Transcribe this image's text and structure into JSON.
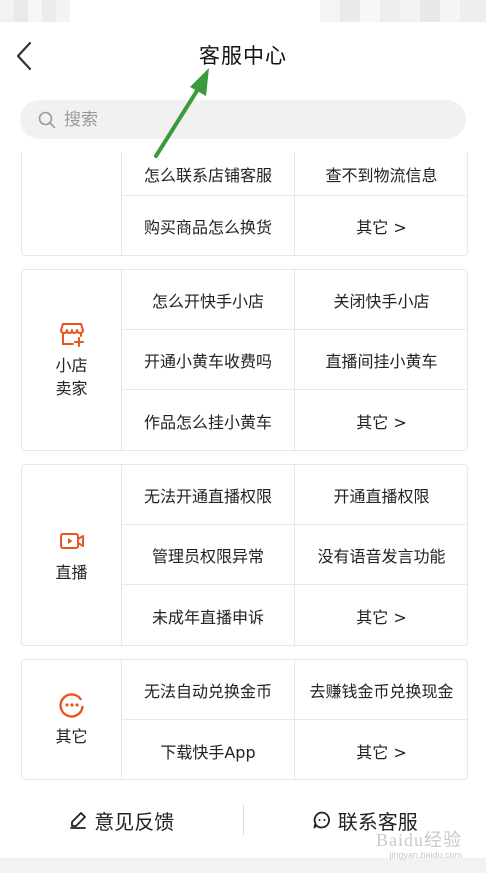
{
  "header": {
    "title": "客服中心"
  },
  "search": {
    "placeholder": "搜索"
  },
  "colors": {
    "accent": "#e8561f",
    "arrow": "#3a9a3c",
    "border": "#e6e6e6"
  },
  "partial_card": {
    "items": [
      "怎么联系店铺客服",
      "查不到物流信息",
      "购买商品怎么换货",
      "其它 >"
    ]
  },
  "categories": [
    {
      "label": "小店卖家",
      "icon": "shop-icon",
      "items": [
        "怎么开快手小店",
        "关闭快手小店",
        "开通小黄车收费吗",
        "直播间挂小黄车",
        "作品怎么挂小黄车",
        "其它 >"
      ]
    },
    {
      "label": "直播",
      "icon": "video-camera-icon",
      "items": [
        "无法开通直播权限",
        "开通直播权限",
        "管理员权限异常",
        "没有语音发言功能",
        "未成年直播申诉",
        "其它 >"
      ]
    },
    {
      "label": "其它",
      "icon": "more-circle-icon",
      "items": [
        "无法自动兑换金币",
        "去赚钱金币兑换现金",
        "下载快手App",
        "其它 >"
      ]
    }
  ],
  "bottom": {
    "feedback": "意见反馈",
    "contact": "联系客服"
  },
  "watermark": {
    "main": "Baidu经验",
    "sub": "jingyan.baidu.com"
  }
}
